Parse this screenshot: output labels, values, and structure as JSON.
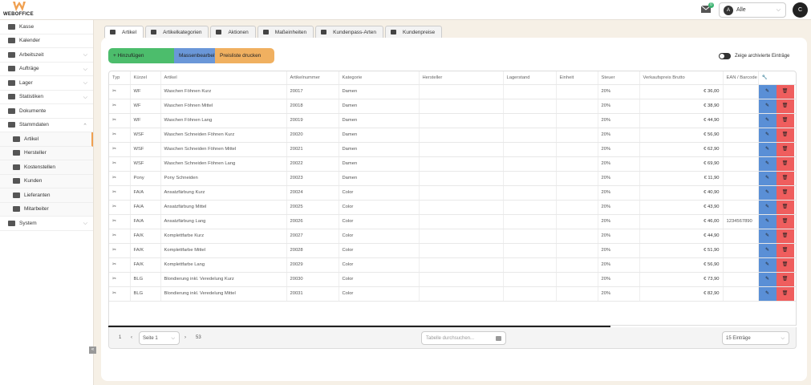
{
  "app": {
    "logo_text": "WEBOFFICE",
    "mail_badge": "0",
    "user_filter": "Alle",
    "user_filter_initial": "A",
    "user_initial": "C"
  },
  "sidebar": {
    "items": [
      {
        "label": "Kasse",
        "icon": "cash-register-icon"
      },
      {
        "label": "Kalender",
        "icon": "calendar-icon"
      },
      {
        "label": "Arbeitszeit",
        "icon": "clock-icon",
        "expandable": true
      },
      {
        "label": "Aufträge",
        "icon": "orders-icon",
        "expandable": true
      },
      {
        "label": "Lager",
        "icon": "warehouse-icon",
        "expandable": true
      },
      {
        "label": "Statistiken",
        "icon": "chart-icon",
        "expandable": true
      },
      {
        "label": "Dokumente",
        "icon": "folder-icon"
      },
      {
        "label": "Stammdaten",
        "icon": "database-icon",
        "expanded": true
      },
      {
        "label": "Artikel",
        "icon": "cart-icon",
        "sub": true,
        "active": true
      },
      {
        "label": "Hersteller",
        "icon": "factory-icon",
        "sub": true
      },
      {
        "label": "Kostenstellen",
        "icon": "grid-icon",
        "sub": true
      },
      {
        "label": "Kunden",
        "icon": "users-icon",
        "sub": true
      },
      {
        "label": "Lieferanten",
        "icon": "truck-icon",
        "sub": true
      },
      {
        "label": "Mitarbeiter",
        "icon": "user-icon",
        "sub": true
      },
      {
        "label": "System",
        "icon": "gears-icon",
        "expandable": true
      }
    ],
    "collapse_glyph": "«"
  },
  "tabs": [
    {
      "label": "Artikel",
      "icon": "cart-icon",
      "active": true
    },
    {
      "label": "Artikelkategorien",
      "icon": "sitemap-icon"
    },
    {
      "label": "Aktionen",
      "icon": "tag-icon"
    },
    {
      "label": "Maßeinheiten",
      "icon": "weight-icon"
    },
    {
      "label": "Kundenpass-Arten",
      "icon": "card-icon"
    },
    {
      "label": "Kundenpreise",
      "icon": "money-icon"
    }
  ],
  "toolbar": {
    "add_label": "+ Hinzufügen",
    "bulk_label": "Massenbearbeitung",
    "print_label": "Preisliste drucken",
    "archive_label": "Zeige archivierte Einträge"
  },
  "table": {
    "columns": [
      "Typ",
      "Kürzel",
      "Artikel",
      "Artikelnummer",
      "Kategorie",
      "Hersteller",
      "Lagerstand",
      "Einheit",
      "Steuer",
      "Verkaufspreis Brutto",
      "EAN / Barcode",
      ""
    ],
    "rows": [
      {
        "typ": "✂",
        "kuerzel": "WF",
        "artikel": "Waschen Föhnen Kurz",
        "nr": "20017",
        "kat": "Damen",
        "hersteller": "",
        "lager": "",
        "einheit": "",
        "steuer": "20%",
        "preis": "€ 36,00",
        "ean": ""
      },
      {
        "typ": "✂",
        "kuerzel": "WF",
        "artikel": "Waschen Föhnen Mittel",
        "nr": "20018",
        "kat": "Damen",
        "hersteller": "",
        "lager": "",
        "einheit": "",
        "steuer": "20%",
        "preis": "€ 38,90",
        "ean": ""
      },
      {
        "typ": "✂",
        "kuerzel": "WF",
        "artikel": "Waschen Föhnen Lang",
        "nr": "20019",
        "kat": "Damen",
        "hersteller": "",
        "lager": "",
        "einheit": "",
        "steuer": "20%",
        "preis": "€ 44,90",
        "ean": ""
      },
      {
        "typ": "✂",
        "kuerzel": "WSF",
        "artikel": "Waschen Schneiden Föhnen Kurz",
        "nr": "20020",
        "kat": "Damen",
        "hersteller": "",
        "lager": "",
        "einheit": "",
        "steuer": "20%",
        "preis": "€ 56,90",
        "ean": ""
      },
      {
        "typ": "✂",
        "kuerzel": "WSF",
        "artikel": "Waschen Schneiden Föhnen Mittel",
        "nr": "20021",
        "kat": "Damen",
        "hersteller": "",
        "lager": "",
        "einheit": "",
        "steuer": "20%",
        "preis": "€ 62,90",
        "ean": ""
      },
      {
        "typ": "✂",
        "kuerzel": "WSF",
        "artikel": "Waschen Schneiden Föhnen Lang",
        "nr": "20022",
        "kat": "Damen",
        "hersteller": "",
        "lager": "",
        "einheit": "",
        "steuer": "20%",
        "preis": "€ 69,90",
        "ean": ""
      },
      {
        "typ": "✂",
        "kuerzel": "Pony",
        "artikel": "Pony Schneiden",
        "nr": "20023",
        "kat": "Damen",
        "hersteller": "",
        "lager": "",
        "einheit": "",
        "steuer": "20%",
        "preis": "€ 11,90",
        "ean": ""
      },
      {
        "typ": "✂",
        "kuerzel": "FA/A",
        "artikel": "Ansatzfärbung Kurz",
        "nr": "20024",
        "kat": "Color",
        "hersteller": "",
        "lager": "",
        "einheit": "",
        "steuer": "20%",
        "preis": "€ 40,90",
        "ean": ""
      },
      {
        "typ": "✂",
        "kuerzel": "FA/A",
        "artikel": "Ansatzfärbung Mittel",
        "nr": "20025",
        "kat": "Color",
        "hersteller": "",
        "lager": "",
        "einheit": "",
        "steuer": "20%",
        "preis": "€ 43,90",
        "ean": ""
      },
      {
        "typ": "✂",
        "kuerzel": "FA/A",
        "artikel": "Ansatzfärbung Lang",
        "nr": "20026",
        "kat": "Color",
        "hersteller": "",
        "lager": "",
        "einheit": "",
        "steuer": "20%",
        "preis": "€ 46,00",
        "ean": "1234567890"
      },
      {
        "typ": "✂",
        "kuerzel": "FA/K",
        "artikel": "Komplettfarbe Kurz",
        "nr": "20027",
        "kat": "Color",
        "hersteller": "",
        "lager": "",
        "einheit": "",
        "steuer": "20%",
        "preis": "€ 44,90",
        "ean": ""
      },
      {
        "typ": "✂",
        "kuerzel": "FA/K",
        "artikel": "Komplettfarbe Mittel",
        "nr": "20028",
        "kat": "Color",
        "hersteller": "",
        "lager": "",
        "einheit": "",
        "steuer": "20%",
        "preis": "€ 51,90",
        "ean": ""
      },
      {
        "typ": "✂",
        "kuerzel": "FA/K",
        "artikel": "Komplettfarbe Lang",
        "nr": "20029",
        "kat": "Color",
        "hersteller": "",
        "lager": "",
        "einheit": "",
        "steuer": "20%",
        "preis": "€ 56,90",
        "ean": ""
      },
      {
        "typ": "✂",
        "kuerzel": "BLG",
        "artikel": "Blondierung inkl. Veredelung Kurz",
        "nr": "20030",
        "kat": "Color",
        "hersteller": "",
        "lager": "",
        "einheit": "",
        "steuer": "20%",
        "preis": "€ 73,90",
        "ean": ""
      },
      {
        "typ": "✂",
        "kuerzel": "BLG",
        "artikel": "Blondierung inkl. Veredelung Mittel",
        "nr": "20031",
        "kat": "Color",
        "hersteller": "",
        "lager": "",
        "einheit": "",
        "steuer": "20%",
        "preis": "€ 82,90",
        "ean": ""
      }
    ],
    "edit_glyph": "✎",
    "delete_glyph": "🗑",
    "actions_header_glyph": "🔧"
  },
  "pager": {
    "first": "1",
    "prev": "‹",
    "page_select": "Seite 1",
    "next": "›",
    "last": "53",
    "search_placeholder": "Tabelle durchsuchen...",
    "entries": "15 Einträge",
    "chevron": "⌵"
  },
  "colors": {
    "add": "#4cbd6c",
    "bulk": "#6a97d8",
    "print": "#f0b060",
    "edit": "#5a8fd6",
    "delete": "#ef5e5e",
    "accent": "#f0a050"
  }
}
